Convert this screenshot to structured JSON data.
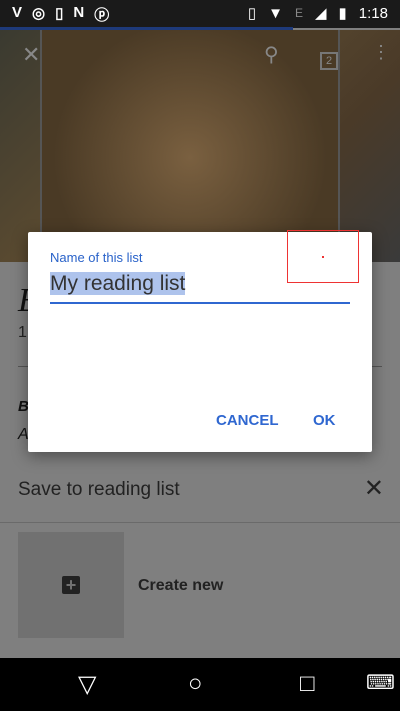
{
  "status_bar": {
    "time": "1:18",
    "network_label": "E",
    "left_icons": [
      "vivaldi-icon",
      "whatsapp-icon",
      "phone-sync-icon",
      "n-icon",
      "pinterest-icon"
    ],
    "right_icons": [
      "vibrate-icon",
      "wifi-icon",
      "signal-icon",
      "battery-charging-icon"
    ]
  },
  "toolbar": {
    "tab_count": "2"
  },
  "page": {
    "title_initial": "E",
    "number_initial": "1",
    "bold_initial": "B",
    "italic_initial": "A"
  },
  "dialog": {
    "label": "Name of this list",
    "input_value": "My reading list",
    "cancel": "CANCEL",
    "ok": "OK",
    "accent": "#2f67d0"
  },
  "sheet": {
    "title": "Save to reading list",
    "create_new": "Create new"
  }
}
